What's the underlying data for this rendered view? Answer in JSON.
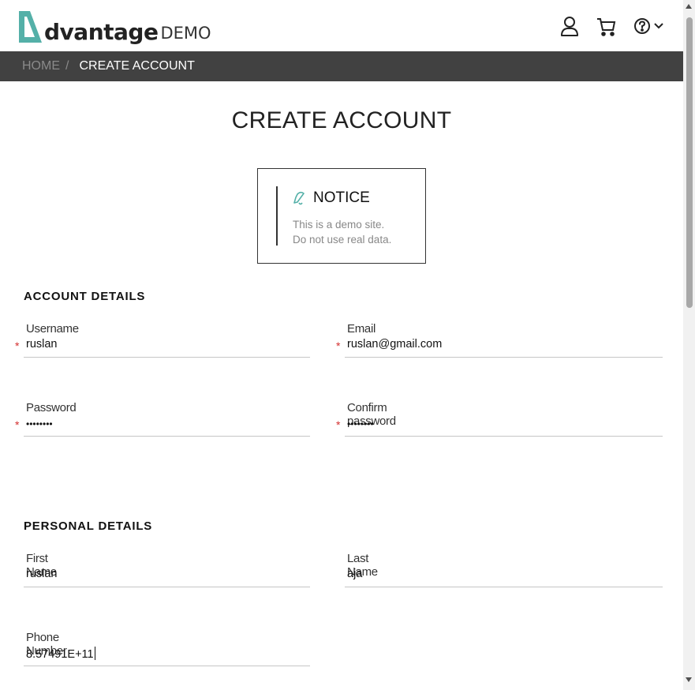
{
  "header": {
    "logo_brand": "dvantage",
    "logo_suffix": "DEMO",
    "colors": {
      "logo_accent": "#54b0a8",
      "bar": "#414141"
    },
    "icons": [
      "user-icon",
      "cart-icon",
      "help-icon",
      "chevron-down-icon"
    ]
  },
  "breadcrumb": {
    "home": "HOME",
    "separator": "/",
    "current": "CREATE ACCOUNT"
  },
  "page": {
    "title": "CREATE ACCOUNT"
  },
  "notice": {
    "title": "NOTICE",
    "line1": "This is a demo site.",
    "line2": "Do not use real data."
  },
  "account_details": {
    "heading": "ACCOUNT DETAILS",
    "username": {
      "label": "Username",
      "value": "ruslan",
      "required_mark": "*"
    },
    "email": {
      "label": "Email",
      "value": "ruslan@gmail.com",
      "required_mark": "*"
    },
    "password": {
      "label": "Password",
      "value": "••••••••",
      "required_mark": "*"
    },
    "confirm_password": {
      "label": "Confirm password",
      "value": "••••••••",
      "required_mark": "*"
    }
  },
  "personal_details": {
    "heading": "PERSONAL DETAILS",
    "first_name": {
      "label": "First Name",
      "value": "ruslan"
    },
    "last_name": {
      "label": "Last Name",
      "value": "aja"
    },
    "phone": {
      "label": "Phone Number",
      "value": "8.57491E+11"
    }
  }
}
